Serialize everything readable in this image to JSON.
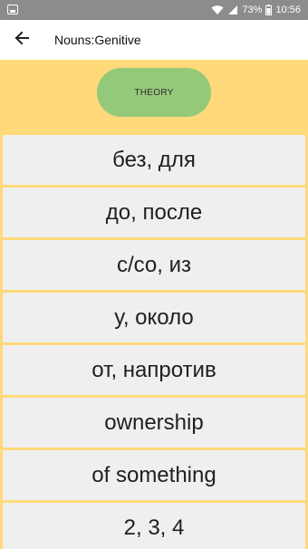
{
  "status_bar": {
    "battery": "73%",
    "time": "10:56"
  },
  "app_bar": {
    "title": "Nouns:Genitive"
  },
  "theory_button": {
    "label": "THEORY"
  },
  "list": {
    "items": [
      "без, для",
      "до, после",
      "с/со, из",
      "у, около",
      "от, напротив",
      "ownership",
      "of something",
      "2, 3, 4"
    ]
  },
  "colors": {
    "background": "#ffd97a",
    "button": "#95c97a",
    "item": "#efefef",
    "status_bar": "#8c8c8c"
  }
}
